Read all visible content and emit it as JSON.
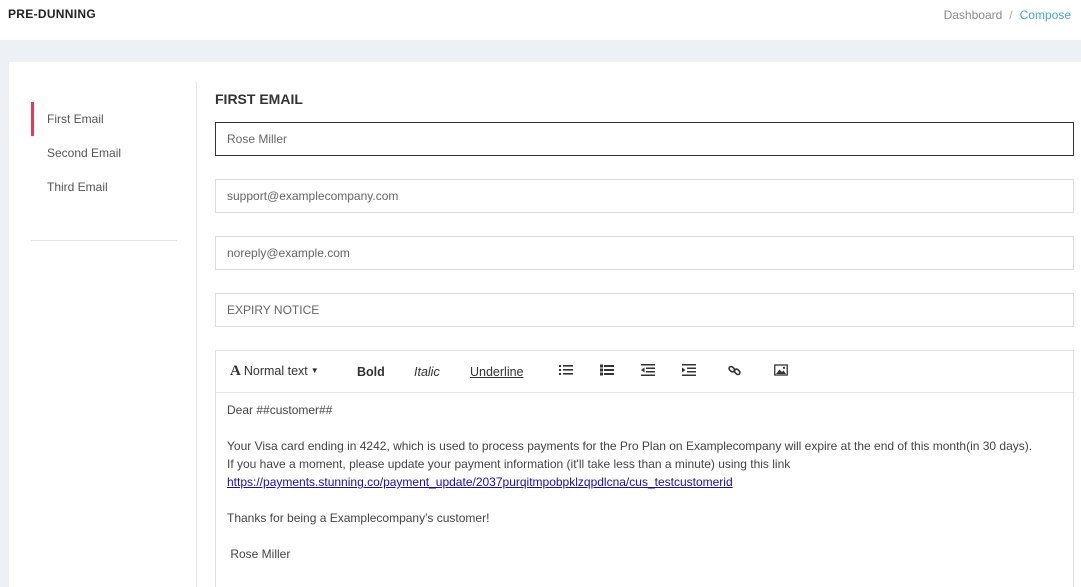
{
  "header": {
    "title": "PRE-DUNNING",
    "breadcrumb": [
      "Dashboard",
      "Compose"
    ],
    "breadcrumb_sep": "/"
  },
  "sidebar": {
    "items": [
      {
        "label": "First Email",
        "active": true
      },
      {
        "label": "Second Email",
        "active": false
      },
      {
        "label": "Third Email",
        "active": false
      }
    ]
  },
  "form": {
    "title": "FIRST EMAIL",
    "sender_name": "Rose Miller",
    "reply_to": "support@examplecompany.com",
    "from_email": "noreply@example.com",
    "subject": "EXPIRY NOTICE"
  },
  "editor": {
    "toolbar": {
      "format_glyph": "A",
      "format_label": "Normal text",
      "bold": "Bold",
      "italic": "Italic",
      "underline": "Underline",
      "icons": [
        "unordered-list-icon",
        "ordered-list-icon",
        "outdent-icon",
        "indent-icon",
        "link-icon",
        "image-icon"
      ]
    },
    "body": {
      "greeting": "Dear  ##customer##",
      "para1": "Your Visa card ending in 4242, which is used to process payments for the Pro Plan on Examplecompany  will expire at the end of this month(in 30 days).",
      "para2": " If you have a moment, please update your payment information (it'll take less than a minute) using this link",
      "link": "https://payments.stunning.co/payment_update/2037purqitmpobpklzqpdlcna/cus_testcustomerid",
      "thanks": "Thanks for being a Examplecompany's customer!",
      "signature": " Rose Miller"
    }
  },
  "colors": {
    "accent": "#e8375a",
    "breadcrumb_active": "#4aa3df",
    "band": "#edf0f4",
    "link": "#1a0dab"
  }
}
